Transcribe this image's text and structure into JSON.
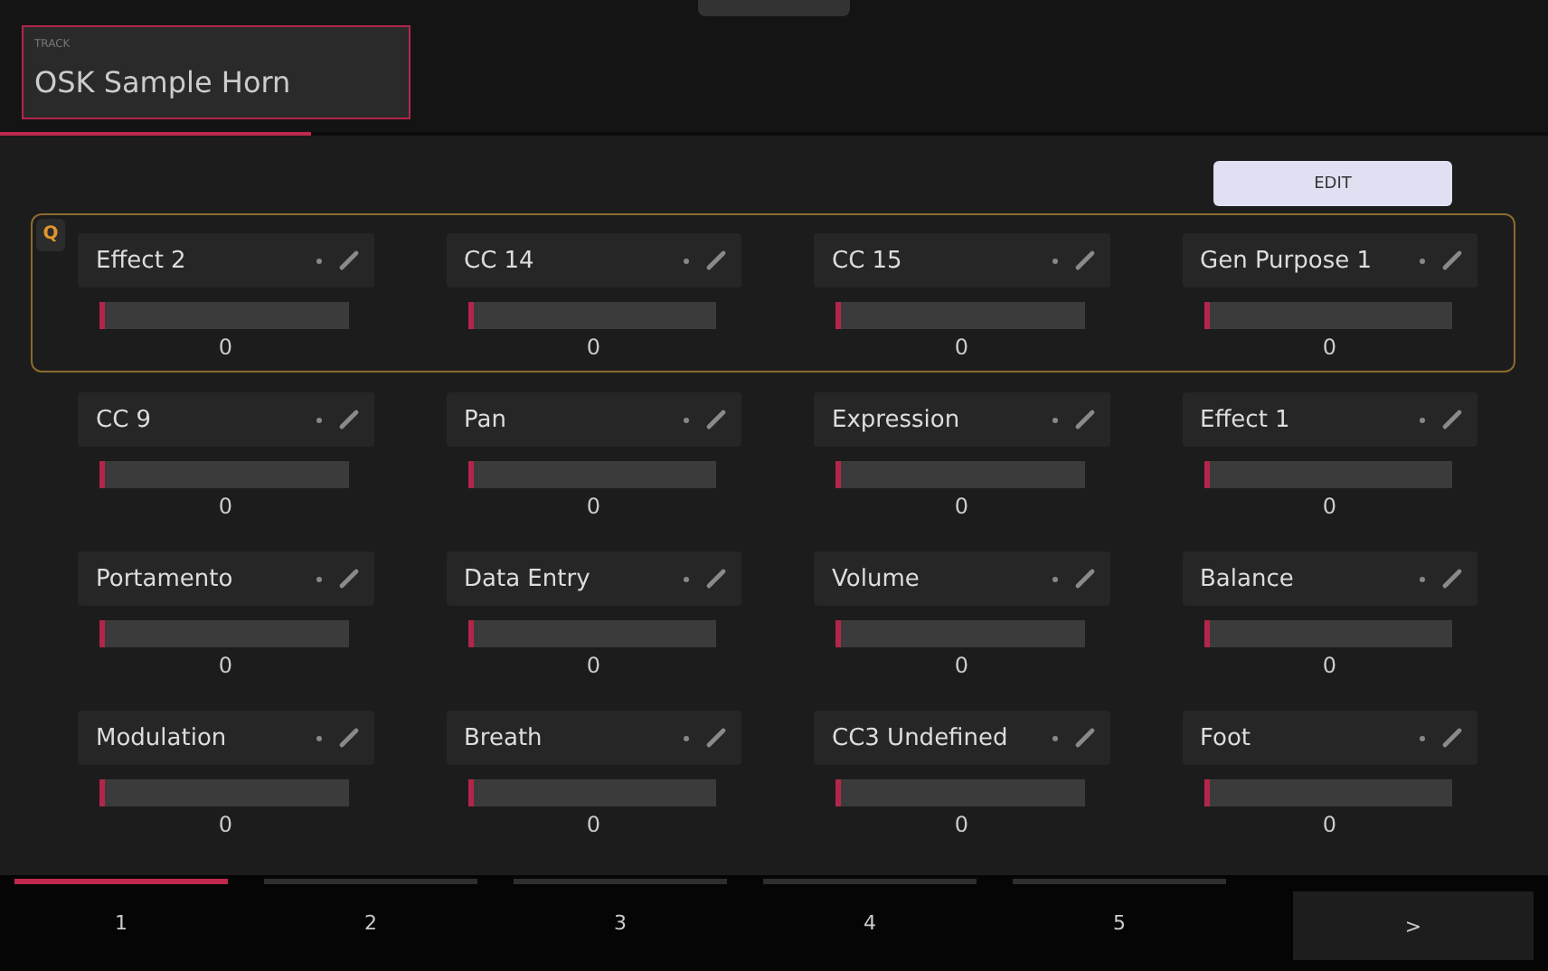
{
  "track": {
    "label": "TRACK",
    "name": "OSK Sample Horn"
  },
  "edit_button": "EDIT",
  "rows": [
    {
      "badge": "Q",
      "highlighted": true,
      "controls": [
        {
          "name": "Effect 2",
          "level": 0,
          "value": "0"
        },
        {
          "name": "CC 14",
          "level": 0,
          "value": "0"
        },
        {
          "name": "CC 15",
          "level": 0,
          "value": "0"
        },
        {
          "name": "Gen Purpose 1",
          "level": 0,
          "value": "0"
        }
      ]
    },
    {
      "highlighted": false,
      "controls": [
        {
          "name": "CC 9",
          "level": 0,
          "value": "0"
        },
        {
          "name": "Pan",
          "level": 0,
          "value": "0"
        },
        {
          "name": "Expression",
          "level": 0,
          "value": "0"
        },
        {
          "name": "Effect 1",
          "level": 0,
          "value": "0"
        }
      ]
    },
    {
      "highlighted": false,
      "controls": [
        {
          "name": "Portamento",
          "level": 0,
          "value": "0"
        },
        {
          "name": "Data Entry",
          "level": 0,
          "value": "0"
        },
        {
          "name": "Volume",
          "level": 0,
          "value": "0"
        },
        {
          "name": "Balance",
          "level": 0,
          "value": "0"
        }
      ]
    },
    {
      "highlighted": false,
      "controls": [
        {
          "name": "Modulation",
          "level": 0,
          "value": "0"
        },
        {
          "name": "Breath",
          "level": 0,
          "value": "0"
        },
        {
          "name": "CC3 Undefined",
          "level": 0,
          "value": "0"
        },
        {
          "name": "Foot",
          "level": 0,
          "value": "0"
        }
      ]
    }
  ],
  "pages": [
    {
      "label": "1",
      "selected": true
    },
    {
      "label": "2",
      "selected": false
    },
    {
      "label": "3",
      "selected": false
    },
    {
      "label": "4",
      "selected": false
    },
    {
      "label": "5",
      "selected": false
    }
  ],
  "next_button": ">"
}
